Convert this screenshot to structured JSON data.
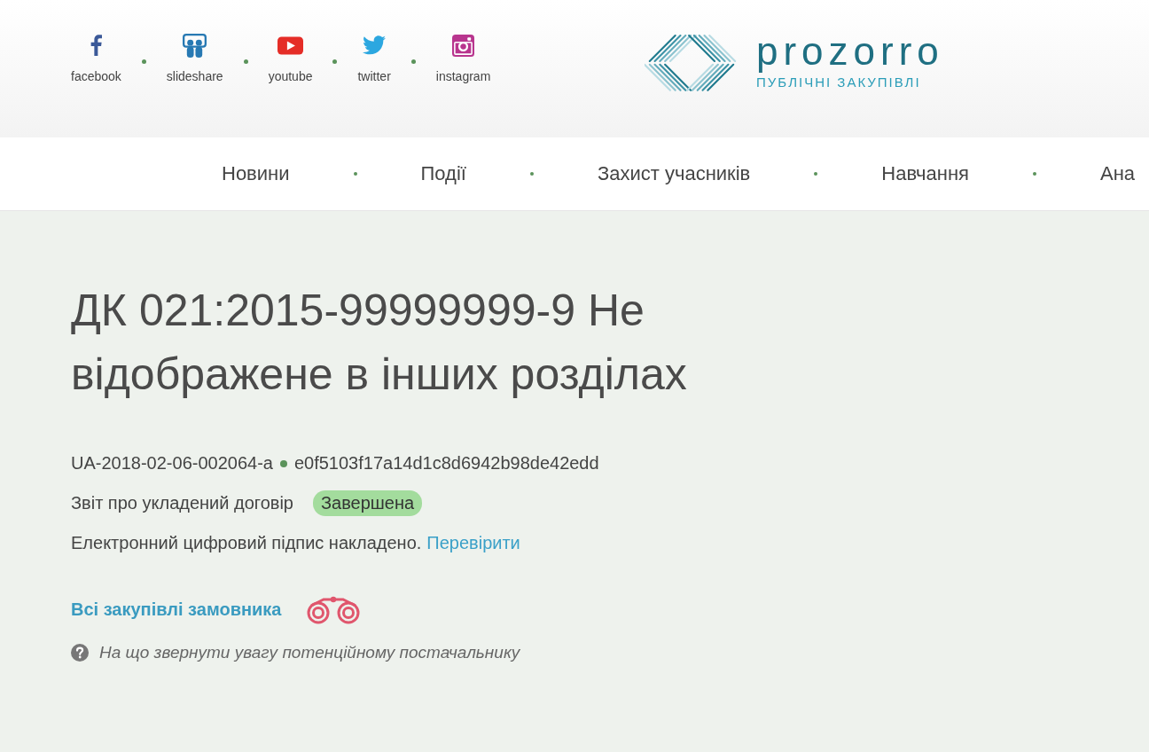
{
  "header": {
    "social_links": [
      {
        "kind": "facebook",
        "label": "facebook"
      },
      {
        "kind": "slideshare",
        "label": "slideshare"
      },
      {
        "kind": "youtube",
        "label": "youtube"
      },
      {
        "kind": "twitter",
        "label": "twitter"
      },
      {
        "kind": "instagram",
        "label": "instagram"
      }
    ],
    "logo": {
      "wordmark": "prozorro",
      "tagline": "ПУБЛІЧНІ ЗАКУПІВЛІ"
    }
  },
  "nav": {
    "items": [
      "Новини",
      "Події",
      "Захист учасників",
      "Навчання",
      "Ана"
    ]
  },
  "tender": {
    "title": "ДК 021:2015-99999999-9 Не відображене в інших розділах",
    "id": "UA-2018-02-06-002064-a",
    "hash": "e0f5103f17a14d1c8d6942b98de42edd",
    "procedure": "Звіт про укладений договір",
    "status": "Завершена",
    "signature": {
      "text": "Електронний цифровий підпис накладено.",
      "link": "Перевірити"
    },
    "buyer_link": "Всі закупівлі замовника",
    "hint": "На що звернути увагу потенційному постачальнику"
  }
}
